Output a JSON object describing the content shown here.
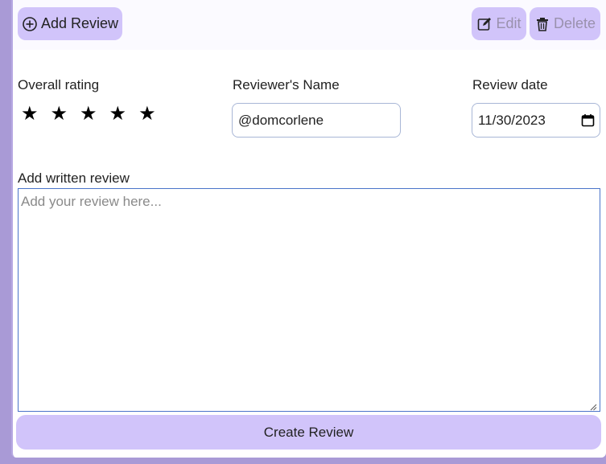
{
  "toolbar": {
    "add_label": "Add Review",
    "edit_label": "Edit",
    "delete_label": "Delete"
  },
  "form": {
    "rating_label": "Overall rating",
    "rating_value": 5,
    "rating_max": 5,
    "stars": [
      "★",
      "★",
      "★",
      "★",
      "★"
    ],
    "name_label": "Reviewer's Name",
    "name_value": "@domcorlene",
    "date_label": "Review date",
    "date_value": "11/30/2023",
    "review_label": "Add written review",
    "review_placeholder": "Add your review here...",
    "review_value": "",
    "submit_label": "Create Review"
  },
  "colors": {
    "accent": "#d1c4fa",
    "background": "#a99ad6",
    "disabled_text": "#9a91ad",
    "focus_border": "#4a74c9"
  },
  "icons": {
    "add": "plus-circle-icon",
    "edit": "pencil-square-icon",
    "delete": "trash-icon",
    "calendar": "calendar-icon",
    "resize": "resize-grip-icon"
  }
}
